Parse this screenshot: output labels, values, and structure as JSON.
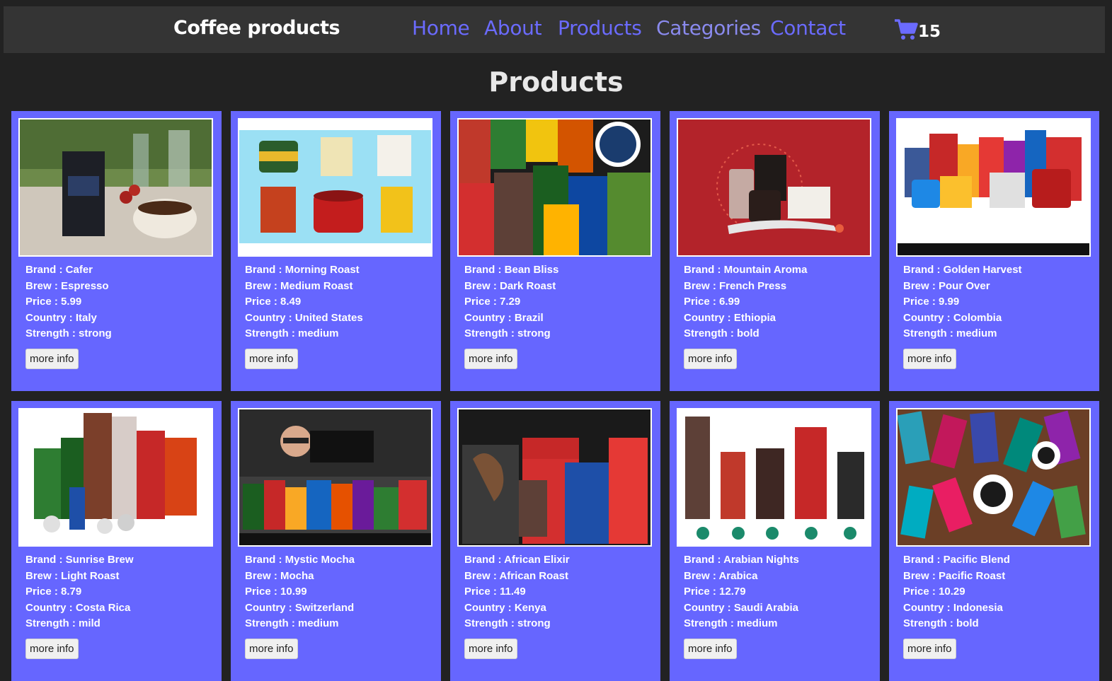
{
  "header": {
    "brand": "Coffee products",
    "nav": [
      {
        "label": "Home"
      },
      {
        "label": "About"
      },
      {
        "label": "Products"
      },
      {
        "label": "Categories"
      },
      {
        "label": "Contact"
      }
    ],
    "cart_icon": "shopping-cart-icon",
    "cart_count": "15"
  },
  "page": {
    "title": "Products"
  },
  "colors": {
    "background": "#222222",
    "navbar": "#343434",
    "card": "#6666ff",
    "nav_link": "#6b6bff"
  },
  "products": [
    {
      "brand": "Brand : Cafer",
      "brew": "Brew : Espresso",
      "price": "Price : 5.99",
      "country": "Country : Italy",
      "strength": "Strength : strong",
      "button": "more info"
    },
    {
      "brand": "Brand : Morning Roast",
      "brew": "Brew : Medium Roast",
      "price": "Price : 8.49",
      "country": "Country : United States",
      "strength": "Strength : medium",
      "button": "more info"
    },
    {
      "brand": "Brand : Bean Bliss",
      "brew": "Brew : Dark Roast",
      "price": "Price : 7.29",
      "country": "Country : Brazil",
      "strength": "Strength : strong",
      "button": "more info"
    },
    {
      "brand": "Brand : Mountain Aroma",
      "brew": "Brew : French Press",
      "price": "Price : 6.99",
      "country": "Country : Ethiopia",
      "strength": "Strength : bold",
      "button": "more info"
    },
    {
      "brand": "Brand : Golden Harvest",
      "brew": "Brew : Pour Over",
      "price": "Price : 9.99",
      "country": "Country : Colombia",
      "strength": "Strength : medium",
      "button": "more info"
    },
    {
      "brand": "Brand : Sunrise Brew",
      "brew": "Brew : Light Roast",
      "price": "Price : 8.79",
      "country": "Country : Costa Rica",
      "strength": "Strength : mild",
      "button": "more info"
    },
    {
      "brand": "Brand : Mystic Mocha",
      "brew": "Brew : Mocha",
      "price": "Price : 10.99",
      "country": "Country : Switzerland",
      "strength": "Strength : medium",
      "button": "more info"
    },
    {
      "brand": "Brand : African Elixir",
      "brew": "Brew : African Roast",
      "price": "Price : 11.49",
      "country": "Country : Kenya",
      "strength": "Strength : strong",
      "button": "more info"
    },
    {
      "brand": "Brand : Arabian Nights",
      "brew": "Brew : Arabica",
      "price": "Price : 12.79",
      "country": "Country : Saudi Arabia",
      "strength": "Strength : medium",
      "button": "more info"
    },
    {
      "brand": "Brand : Pacific Blend",
      "brew": "Brew : Pacific Roast",
      "price": "Price : 10.29",
      "country": "Country : Indonesia",
      "strength": "Strength : bold",
      "button": "more info"
    }
  ]
}
